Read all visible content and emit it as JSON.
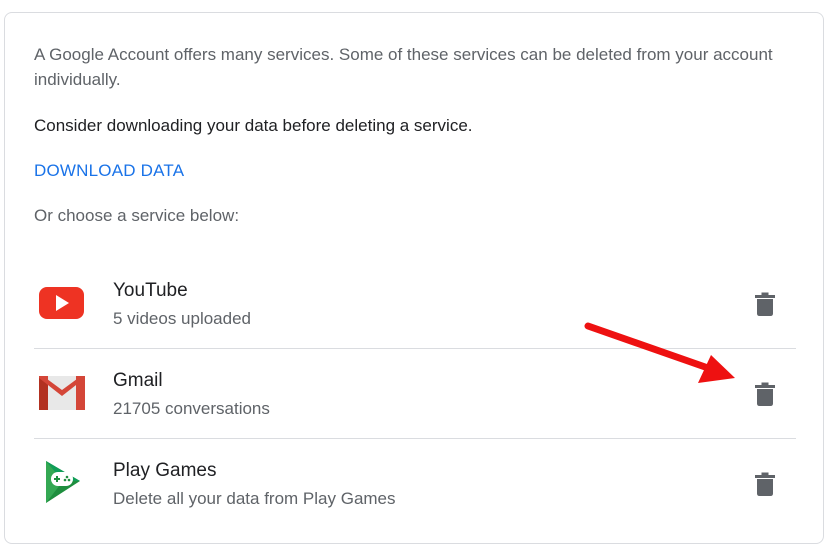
{
  "intro_text": "A Google Account offers many services. Some of these services can be deleted from your account individually.",
  "consider_text": "Consider downloading your data before deleting a service.",
  "download_label": "DOWNLOAD DATA",
  "choose_text": "Or choose a service below:",
  "services": [
    {
      "name": "YouTube",
      "detail": "5 videos uploaded",
      "icon": "youtube-logo"
    },
    {
      "name": "Gmail",
      "detail": "21705 conversations",
      "icon": "gmail-logo"
    },
    {
      "name": "Play Games",
      "detail": "Delete all your data from Play Games",
      "icon": "play-games-logo"
    }
  ],
  "colors": {
    "link": "#1a73e8",
    "annotation_arrow": "#ee1111",
    "trash_icon": "#5f6368"
  }
}
